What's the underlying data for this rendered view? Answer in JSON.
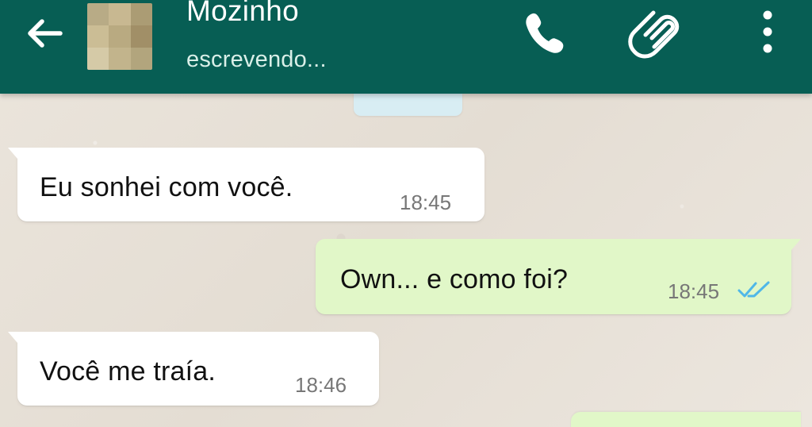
{
  "header": {
    "contact_name": "Mozinho",
    "status": "escrevendo...",
    "background_color": "#075e54",
    "icons": {
      "back": "back-arrow-icon",
      "call": "phone-icon",
      "attach": "paperclip-icon",
      "menu": "vertical-dots-icon"
    }
  },
  "messages": [
    {
      "direction": "incoming",
      "text": "Eu sonhei com você.",
      "time": "18:45"
    },
    {
      "direction": "outgoing",
      "text": "Own... e como foi?",
      "time": "18:45",
      "status_icon": "read-checkmarks-icon"
    },
    {
      "direction": "incoming",
      "text": "Você me traía.",
      "time": "18:46"
    }
  ],
  "colors": {
    "incoming_bubble": "#ffffff",
    "outgoing_bubble": "#e1f7c8",
    "read_ticks": "#4fb7e8",
    "chat_background": "#e8e2da"
  }
}
